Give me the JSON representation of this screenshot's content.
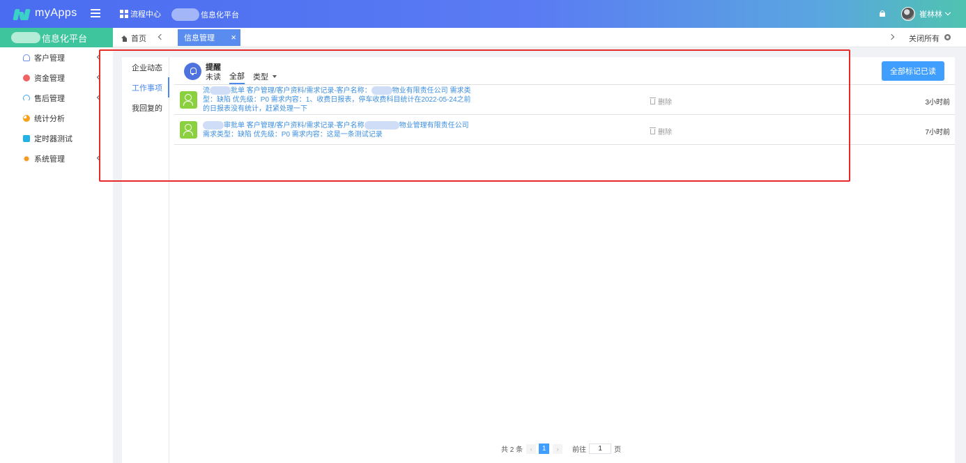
{
  "app": {
    "name": "myApps"
  },
  "topbar": {
    "nav_label": "流程中心",
    "platform_label": "信息化平台",
    "user_name": "崔林林"
  },
  "sidebar": {
    "header": "信息化平台",
    "items": [
      {
        "label": "客户管理",
        "icon": "user-icon",
        "has_arrow": true
      },
      {
        "label": "资金管理",
        "icon": "money-icon",
        "has_arrow": true
      },
      {
        "label": "售后管理",
        "icon": "headset-icon",
        "has_arrow": true
      },
      {
        "label": "统计分析",
        "icon": "chart-icon",
        "has_arrow": false
      },
      {
        "label": "定时器测试",
        "icon": "timer-icon",
        "has_arrow": false
      },
      {
        "label": "系统管理",
        "icon": "gear-icon",
        "has_arrow": true
      }
    ]
  },
  "tabs": {
    "home": "首页",
    "active": "信息管理",
    "close_all": "关闭所有"
  },
  "subnav": [
    "企业动态",
    "工作事项",
    "我回复的"
  ],
  "subnav_active": 1,
  "notices": {
    "title": "提醒",
    "filters": {
      "unread": "未读",
      "all": "全部",
      "type": "类型"
    },
    "mark_all": "全部标记已读",
    "rows": [
      {
        "line1_a": "流",
        "line1_b": "批单 客户管理/客户资料/需求记录-客户名称：",
        "line1_c": "物业有限责任公司 需求类",
        "line2": "型：缺陷 优先级：P0 需求内容：1、收费日报表，停车收费科目统计在2022-05-24之前",
        "line3": "的日报表没有统计，赶紧处理一下",
        "delete": "删除",
        "time": "3小时前"
      },
      {
        "line1_a": "",
        "line1_b": "审批单 客户管理/客户资料/需求记录-客户名称",
        "line1_c": "物业管理有限责任公司",
        "line2": "需求类型：缺陷 优先级：P0 需求内容：这是一条测试记录",
        "line3": "",
        "delete": "删除",
        "time": "7小时前"
      }
    ]
  },
  "pagination": {
    "total": "共 2 条",
    "current": "1",
    "goto": "前往",
    "page_value": "1",
    "page_suffix": "页"
  },
  "colors": {
    "accent": "#409eff",
    "sidebar_header": "#3fc59d",
    "highlight": "#e62828"
  }
}
